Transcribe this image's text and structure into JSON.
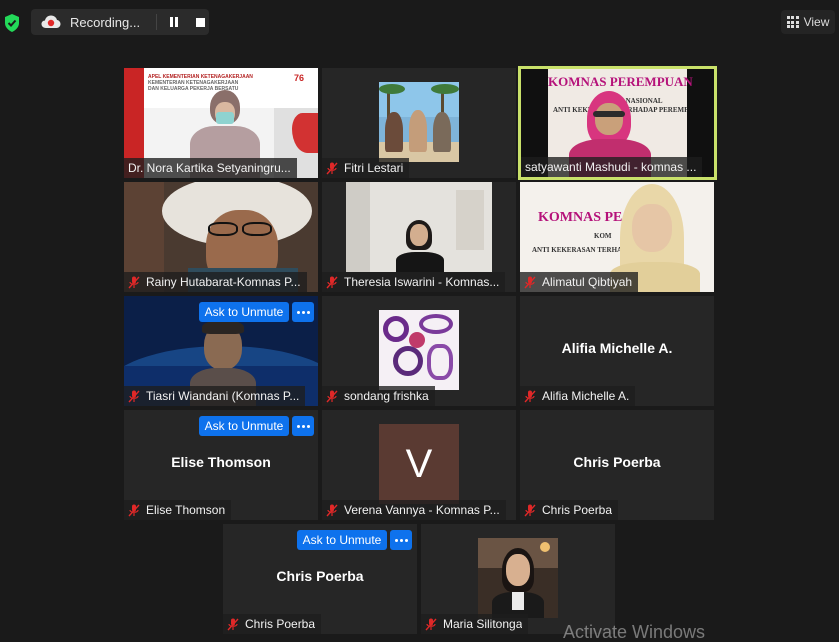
{
  "topbar": {
    "recording_label": "Recording...",
    "view_label": "View"
  },
  "participants": [
    {
      "name": "Dr. Nora Kartika Setyaningru..."
    },
    {
      "name": "Fitri Lestari"
    },
    {
      "name": "satyawanti Mashudi - komnas ..."
    },
    {
      "name": "Rainy Hutabarat-Komnas P..."
    },
    {
      "name": "Theresia Iswarini - Komnas..."
    },
    {
      "name": "Alimatul Qibtiyah"
    },
    {
      "name": "Tiasri Wiandani (Komnas P..."
    },
    {
      "name": "sondang frishka"
    },
    {
      "name": "Alifia Michelle A.",
      "display_name": "Alifia Michelle A."
    },
    {
      "name": "Elise Thomson",
      "display_name": "Elise Thomson"
    },
    {
      "name": "Verena Vannya - Komnas P...",
      "initial": "V"
    },
    {
      "name": "Chris Poerba",
      "display_name": "Chris Poerba"
    },
    {
      "name": "Chris Poerba",
      "display_name": "Chris Poerba"
    },
    {
      "name": "Maria Silitonga"
    }
  ],
  "overlays": {
    "ask_to_unmute_label": "Ask to Unmute"
  },
  "backgrounds": {
    "apel_banner_line1": "APEL KEMENTERIAN KETENAGAKERJAAN",
    "apel_banner_line2": "KEMENTERIAN KETENAGAKERJAAN",
    "apel_banner_line3": "DAN KELUARGA PEKERJA BERSATU",
    "apel_number": "76",
    "komnas_banner": "KOMNAS PEREMPUAN",
    "komnas_subline1": "KOMISI NASIONAL",
    "komnas_subline2": "ANTI KEKERASAN TERHADAP PEREMPUAN",
    "komnas_banner_partial": "KOMNAS PE",
    "komnas_sub_partial1": "KOM",
    "komnas_sub_partial2": "ANTI KEKERASAN TERHADAP PUAN"
  },
  "watermark": "Activate Windows",
  "colors": {
    "active_speaker": "#c9e16a",
    "unmute_button": "#0e72ed",
    "tile_bg": "#262626",
    "muted_mic": "#e02828"
  }
}
